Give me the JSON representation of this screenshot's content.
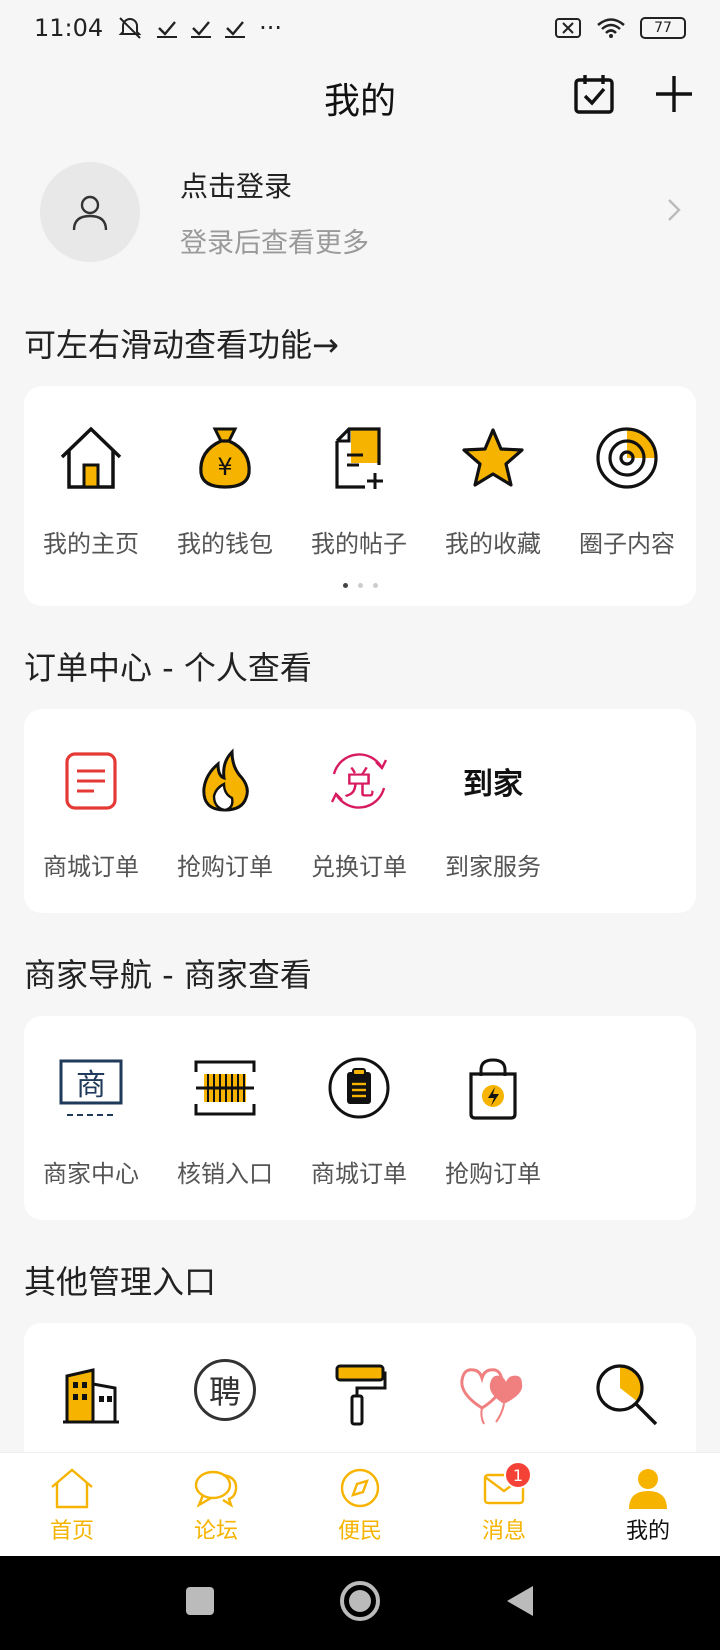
{
  "status_bar": {
    "time": "11:04",
    "more": "···",
    "battery": "77"
  },
  "header": {
    "title": "我的"
  },
  "profile": {
    "login": "点击登录",
    "subtitle": "登录后查看更多"
  },
  "features": {
    "title": "可左右滑动查看功能→",
    "items": [
      {
        "label": "我的主页",
        "icon": "home-icon"
      },
      {
        "label": "我的钱包",
        "icon": "money-bag-icon"
      },
      {
        "label": "我的帖子",
        "icon": "post-icon"
      },
      {
        "label": "我的收藏",
        "icon": "star-icon"
      },
      {
        "label": "圈子内容",
        "icon": "circle-icon"
      }
    ],
    "page_dots": 3,
    "active_dot": 0
  },
  "orders": {
    "title": "订单中心 - 个人查看",
    "items": [
      {
        "label": "商城订单",
        "icon": "order-list-icon"
      },
      {
        "label": "抢购订单",
        "icon": "flame-icon"
      },
      {
        "label": "兑换订单",
        "icon": "exchange-icon",
        "glyph": "兑"
      },
      {
        "label": "到家服务",
        "icon": "home-service-icon",
        "glyph": "到家"
      }
    ]
  },
  "merchant": {
    "title": "商家导航 - 商家查看",
    "items": [
      {
        "label": "商家中心",
        "icon": "merchant-icon",
        "glyph": "商"
      },
      {
        "label": "核销入口",
        "icon": "barcode-icon"
      },
      {
        "label": "商城订单",
        "icon": "clipboard-icon"
      },
      {
        "label": "抢购订单",
        "icon": "flash-bag-icon"
      }
    ]
  },
  "other": {
    "title": "其他管理入口",
    "items": [
      {
        "icon": "building-icon"
      },
      {
        "icon": "recruit-icon",
        "glyph": "聘"
      },
      {
        "icon": "paint-roller-icon"
      },
      {
        "icon": "balloon-hearts-icon"
      },
      {
        "icon": "search-icon"
      }
    ]
  },
  "tabbar": {
    "tabs": [
      {
        "label": "首页",
        "icon": "home-tab-icon"
      },
      {
        "label": "论坛",
        "icon": "chat-tab-icon"
      },
      {
        "label": "便民",
        "icon": "compass-tab-icon"
      },
      {
        "label": "消息",
        "icon": "mail-tab-icon",
        "badge": "1"
      },
      {
        "label": "我的",
        "icon": "person-tab-icon",
        "active": true
      }
    ]
  },
  "colors": {
    "accent": "#F6B400",
    "badge": "#F44336",
    "order_red": "#E53935",
    "exchange_pink": "#D81B60"
  }
}
